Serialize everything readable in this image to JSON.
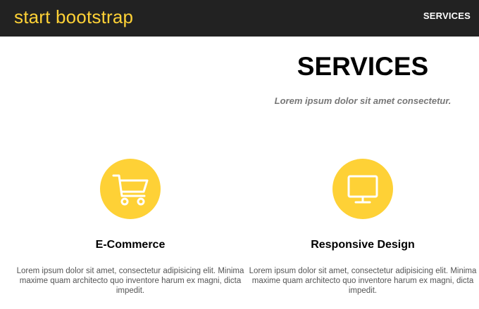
{
  "navbar": {
    "brand": "start bootstrap",
    "link_services": "SERVICES"
  },
  "services_section": {
    "heading": "SERVICES",
    "subheading": "Lorem ipsum dolor sit amet consectetur."
  },
  "services": [
    {
      "icon": "shopping-cart-icon",
      "title": "E-Commerce",
      "text": "Lorem ipsum dolor sit amet, consectetur adipisicing elit. Minima maxime quam architecto quo inventore harum ex magni, dicta impedit."
    },
    {
      "icon": "desktop-monitor-icon",
      "title": "Responsive Design",
      "text": "Lorem ipsum dolor sit amet, consectetur adipisicing elit. Minima maxime quam architecto quo inventore harum ex magni, dicta impedit."
    }
  ],
  "colors": {
    "navbar_bg": "#222222",
    "accent": "#fed136",
    "nav_text": "#ffffff",
    "muted_text": "#777777",
    "body_text": "#555555"
  }
}
